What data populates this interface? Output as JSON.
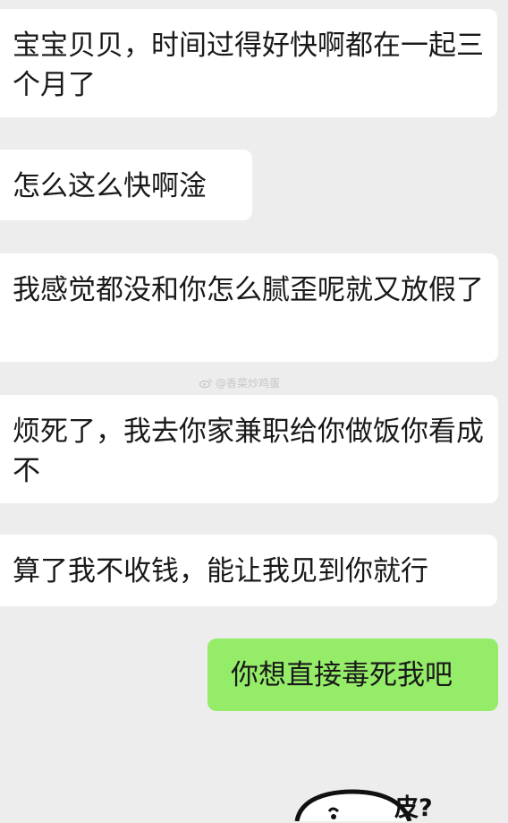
{
  "messages": [
    {
      "side": "received",
      "text": "宝宝贝贝，时间过得好快啊都在一起三个月了"
    },
    {
      "side": "received",
      "text": "怎么这么快啊淦"
    },
    {
      "side": "received",
      "text": "我感觉都没和你怎么腻歪呢就又放假了"
    },
    {
      "side": "received",
      "text": "烦死了，我去你家兼职给你做饭你看成不"
    },
    {
      "side": "received",
      "text": "算了我不收钱，能让我见到你就行"
    },
    {
      "side": "sent",
      "text": "你想直接毒死我吧"
    }
  ],
  "watermark": {
    "icon": "weibo-logo-icon",
    "text": "@香菜炒鸡蛋"
  },
  "sticker": {
    "icon": "cartoon-face-sticker-icon",
    "text": "皮?"
  },
  "colors": {
    "background": "#ededed",
    "received_bubble": "#ffffff",
    "sent_bubble": "#95ec69",
    "text": "#191919"
  }
}
